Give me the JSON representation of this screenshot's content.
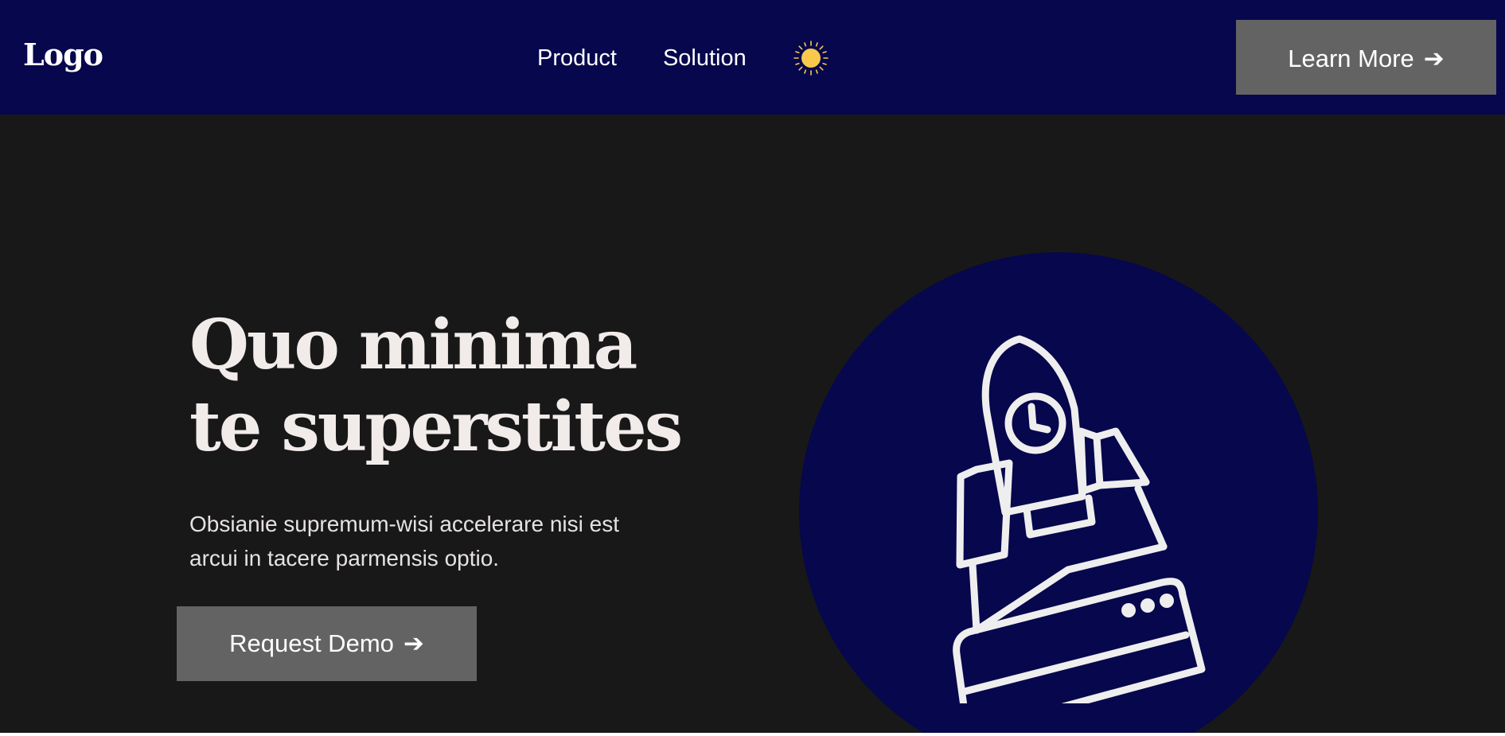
{
  "header": {
    "logo": "Logo",
    "nav": [
      {
        "label": "Product"
      },
      {
        "label": "Solution"
      }
    ],
    "theme_toggle_icon": "sun-icon",
    "cta_label": "Learn More",
    "cta_arrow": "➔"
  },
  "hero": {
    "title": "Quo minima te superstites",
    "subtitle": "Obsianie supremum-wisi accelerare nisi est arcui in tacere parmensis optio.",
    "cta_label": "Request Demo",
    "cta_arrow": "➔",
    "illustration_icon": "rocket-launch-icon"
  },
  "colors": {
    "navbar_bg": "#06074c",
    "hero_bg": "#181818",
    "button_bg": "#646364",
    "sun": "#f9c94c",
    "text_light": "#f1ebea"
  }
}
